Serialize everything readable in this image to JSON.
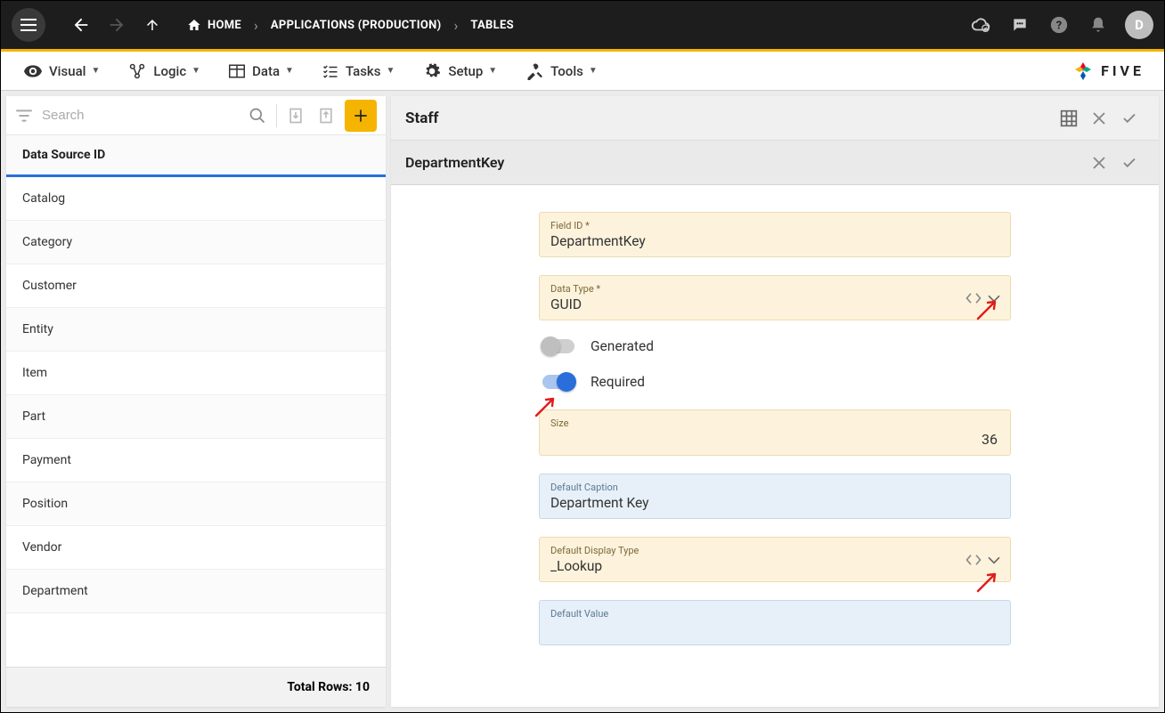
{
  "topbar": {
    "breadcrumbs": {
      "home": "HOME",
      "apps": "APPLICATIONS (PRODUCTION)",
      "tables": "TABLES"
    },
    "avatar_initial": "D"
  },
  "menubar": {
    "visual": "Visual",
    "logic": "Logic",
    "data": "Data",
    "tasks": "Tasks",
    "setup": "Setup",
    "tools": "Tools",
    "brand": "FIVE"
  },
  "left": {
    "search_placeholder": "Search",
    "column_header": "Data Source ID",
    "rows": [
      "Catalog",
      "Category",
      "Customer",
      "Entity",
      "Item",
      "Part",
      "Payment",
      "Position",
      "Vendor",
      "Department"
    ],
    "footer": "Total Rows: 10"
  },
  "right": {
    "header1": "Staff",
    "header2": "DepartmentKey",
    "form": {
      "field_id": {
        "label": "Field ID *",
        "value": "DepartmentKey"
      },
      "data_type": {
        "label": "Data Type *",
        "value": "GUID"
      },
      "generated": {
        "label": "Generated",
        "on": false
      },
      "required": {
        "label": "Required",
        "on": true
      },
      "size": {
        "label": "Size",
        "value": "36"
      },
      "default_caption": {
        "label": "Default Caption",
        "value": "Department Key"
      },
      "default_display_type": {
        "label": "Default Display Type",
        "value": "_Lookup"
      },
      "default_value": {
        "label": "Default Value",
        "value": ""
      }
    }
  }
}
